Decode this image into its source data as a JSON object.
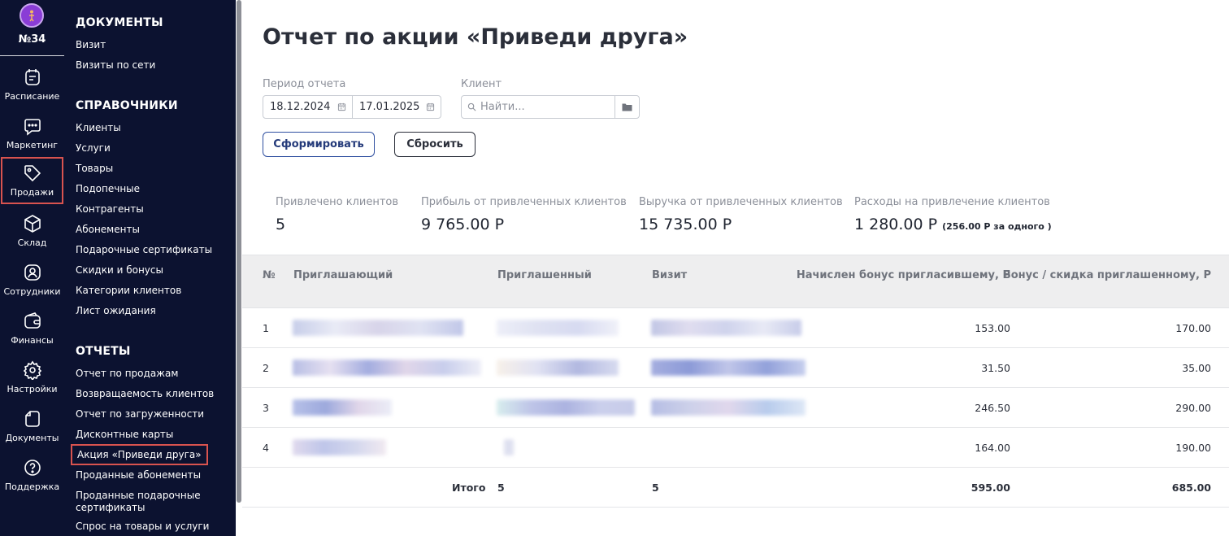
{
  "rail": {
    "club_number": "№34",
    "items": [
      {
        "label": "Расписание",
        "icon": "calendar-icon"
      },
      {
        "label": "Маркетинг",
        "icon": "chat-icon"
      },
      {
        "label": "Продажи",
        "icon": "tag-icon",
        "active": true
      },
      {
        "label": "Склад",
        "icon": "box-icon"
      },
      {
        "label": "Сотрудники",
        "icon": "person-icon"
      },
      {
        "label": "Финансы",
        "icon": "wallet-icon"
      },
      {
        "label": "Настройки",
        "icon": "gear-icon"
      },
      {
        "label": "Документы",
        "icon": "document-icon"
      },
      {
        "label": "Поддержка",
        "icon": "help-icon"
      }
    ]
  },
  "submenu": {
    "documents": {
      "title": "ДОКУМЕНТЫ",
      "items": [
        "Визит",
        "Визиты по сети"
      ]
    },
    "references": {
      "title": "СПРАВОЧНИКИ",
      "items": [
        "Клиенты",
        "Услуги",
        "Товары",
        "Подопечные",
        "Контрагенты",
        "Абонементы",
        "Подарочные сертификаты",
        "Скидки и бонусы",
        "Категории клиентов",
        "Лист ожидания"
      ]
    },
    "reports": {
      "title": "ОТЧЕТЫ",
      "items": [
        "Отчет по продажам",
        "Возвращаемость клиентов",
        "Отчет по загруженности",
        "Дисконтные карты",
        "Акция «Приведи друга»",
        "Проданные абонементы",
        "Проданные подарочные сертификаты",
        "Спрос на товары и услуги"
      ]
    }
  },
  "main": {
    "title": "Отчет по акции «Приведи друга»",
    "period_label": "Период отчета",
    "date_from": "18.12.2024",
    "date_to": "17.01.2025",
    "client_label": "Клиент",
    "client_placeholder": "Найти...",
    "submit_label": "Сформировать",
    "reset_label": "Сбросить",
    "stats": [
      {
        "label": "Привлечено клиентов",
        "value": "5",
        "extra": ""
      },
      {
        "label": "Прибыль от привлеченных клиентов",
        "value": "9 765.00 Р",
        "extra": ""
      },
      {
        "label": "Выручка от привлеченных клиентов",
        "value": "15 735.00 Р",
        "extra": ""
      },
      {
        "label": "Расходы на привлечение клиентов",
        "value": "1 280.00 Р",
        "extra": "(256.00 Р за одного )"
      }
    ],
    "table": {
      "headers": [
        "№",
        "Приглашающий",
        "Приглашенный",
        "Визит",
        "Начислен бонус пригласившему, Р",
        "Бонус / скидка приглашенному, Р"
      ],
      "rows": [
        {
          "n": "1",
          "bonus_inviter": "153.00",
          "bonus_invited": "170.00"
        },
        {
          "n": "2",
          "bonus_inviter": "31.50",
          "bonus_invited": "35.00"
        },
        {
          "n": "3",
          "bonus_inviter": "246.50",
          "bonus_invited": "290.00"
        },
        {
          "n": "4",
          "bonus_inviter": "164.00",
          "bonus_invited": "190.00"
        }
      ],
      "total": {
        "label": "Итого",
        "invited": "5",
        "visits": "5",
        "bonus_inviter": "595.00",
        "bonus_invited": "685.00"
      }
    }
  },
  "colors": {
    "sidebar_bg": "#0c1230",
    "active_outline": "#d9534f",
    "primary_button_border": "#2f4fa0",
    "table_header_bg": "#eeeeef"
  }
}
